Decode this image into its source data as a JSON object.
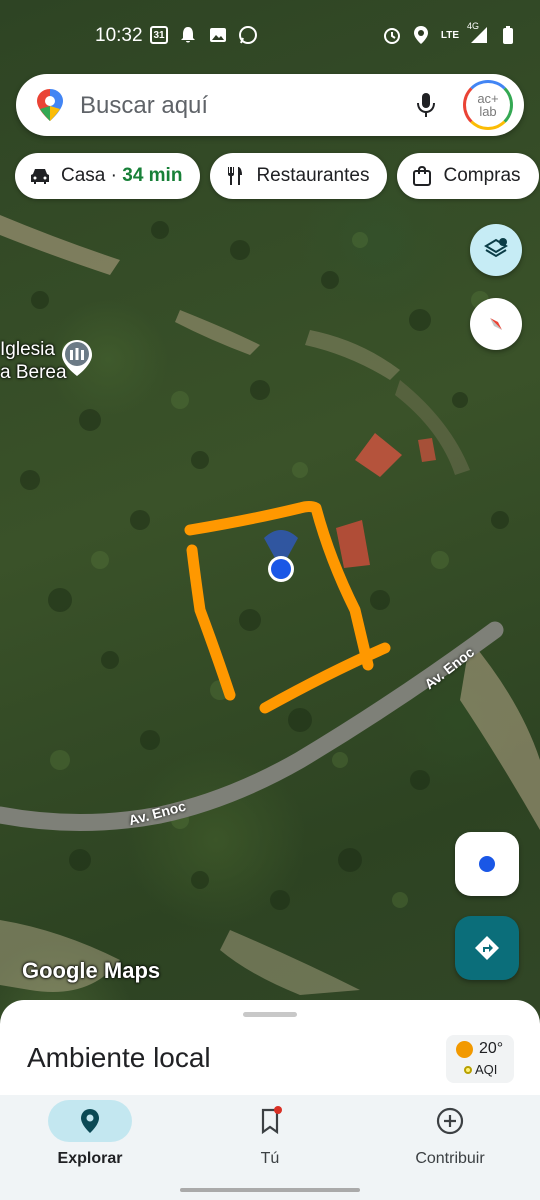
{
  "status_bar": {
    "time": "10:32",
    "calendar_day": "31",
    "network_label": "LTE",
    "network_type": "4G"
  },
  "search": {
    "placeholder": "Buscar aquí",
    "avatar_text_line1": "ac+",
    "avatar_text_line2": "lab"
  },
  "chips": [
    {
      "icon": "car-icon",
      "label": "Casa · ",
      "highlight": "34 min"
    },
    {
      "icon": "fork-knife-icon",
      "label": "Restaurantes"
    },
    {
      "icon": "shopping-bag-icon",
      "label": "Compras"
    }
  ],
  "map": {
    "place_label_line1": "Iglesia",
    "place_label_line2": "a Berea",
    "road_label_1": "Av. Enoc",
    "road_label_2": "Av. Enoc",
    "watermark": "Google Maps"
  },
  "sheet": {
    "title": "Ambiente local",
    "temperature": "20°",
    "aqi_label": "AQI"
  },
  "nav": {
    "explore": "Explorar",
    "you": "Tú",
    "contribute": "Contribuir"
  },
  "colors": {
    "accent_teal": "#0b6e7a",
    "location_blue": "#1a57e6",
    "annotation_orange": "#ff9800",
    "travel_green": "#188038"
  }
}
